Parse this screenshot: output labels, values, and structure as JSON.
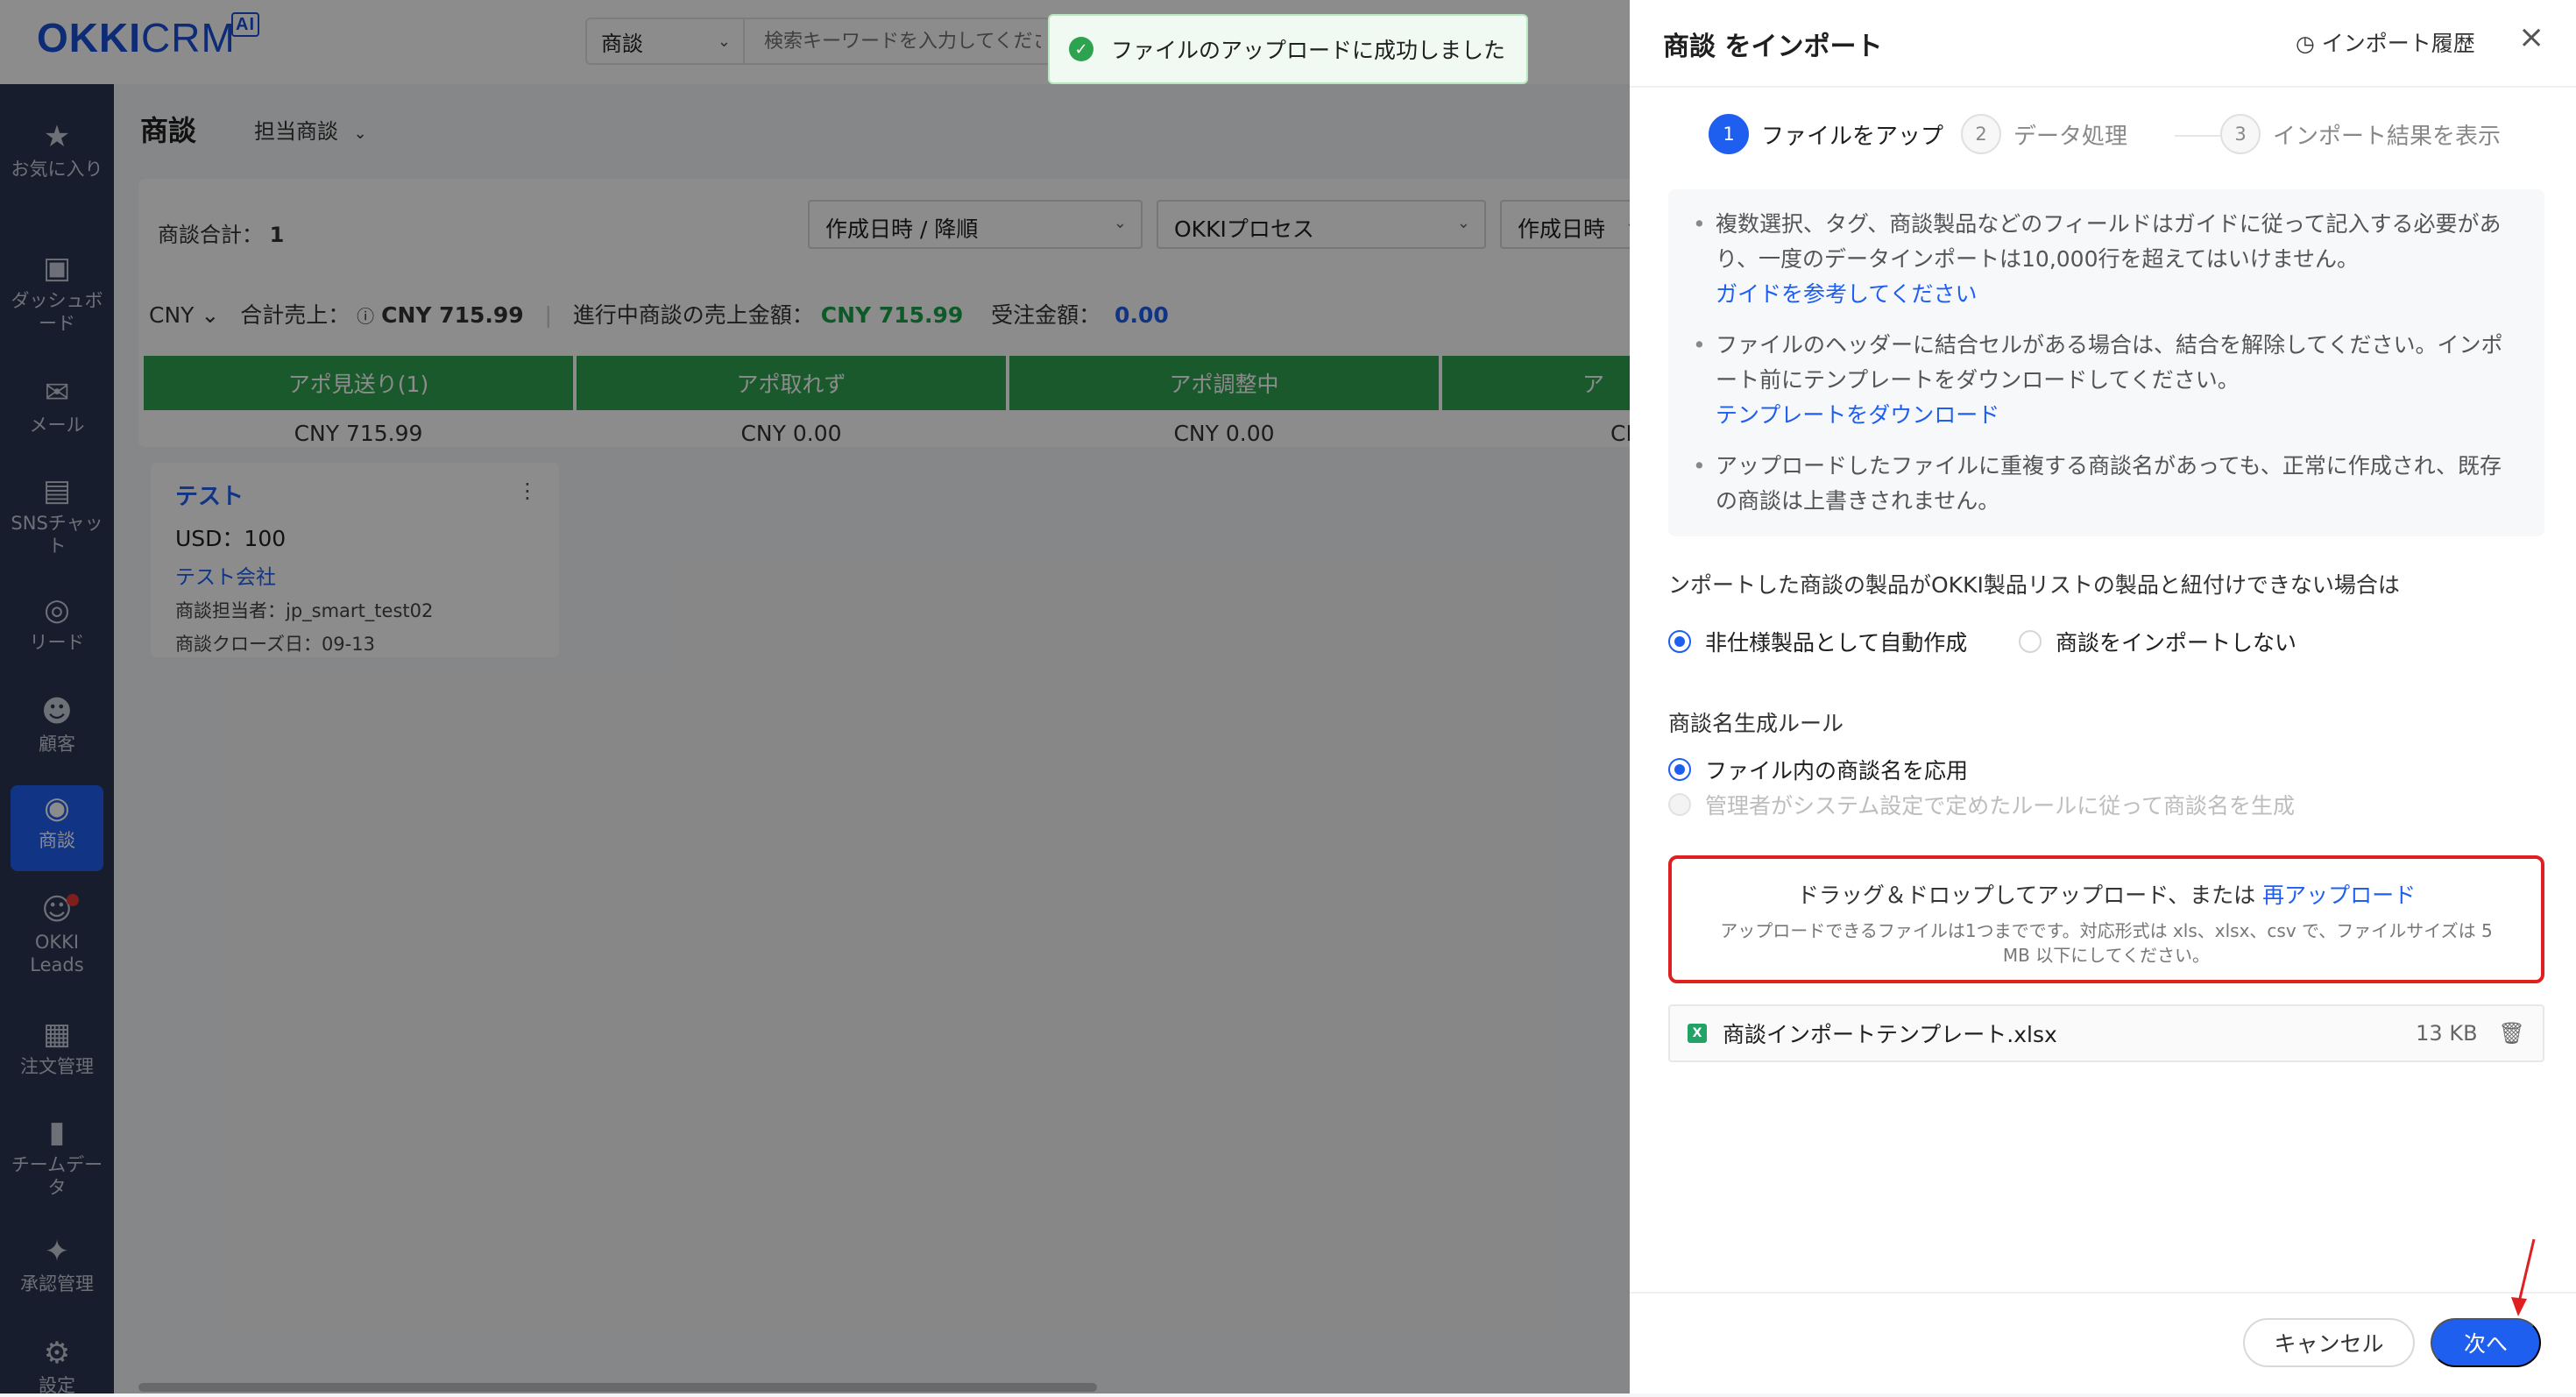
{
  "header": {
    "logo_main": "OKKI",
    "logo_crm": "CRM",
    "logo_ai": "AI",
    "search_scope": "商談",
    "search_placeholder": "検索キーワードを入力してください"
  },
  "sidebar": {
    "items": [
      {
        "label": "お気に入り",
        "icon": "star-icon"
      },
      {
        "label": "ダッシュボード",
        "icon": "dashboard-icon"
      },
      {
        "label": "メール",
        "icon": "mail-icon"
      },
      {
        "label": "SNSチャット",
        "icon": "chat-icon"
      },
      {
        "label": "リード",
        "icon": "lead-icon"
      },
      {
        "label": "顧客",
        "icon": "customers-icon"
      },
      {
        "label": "商談",
        "icon": "target-icon"
      },
      {
        "label": "OKKI Leads",
        "icon": "okki-leads-icon"
      },
      {
        "label": "注文管理",
        "icon": "order-icon"
      },
      {
        "label": "チームデータ",
        "icon": "bar-chart-icon"
      },
      {
        "label": "承認管理",
        "icon": "approval-icon"
      },
      {
        "label": "設定",
        "icon": "settings-icon"
      }
    ]
  },
  "main": {
    "title": "商談",
    "view": "担当商談",
    "count_label": "商談合計：",
    "count_value": "1",
    "sort": "作成日時 / 降順",
    "process": "OKKIプロセス",
    "date_filter": "作成日時",
    "currency": "CNY",
    "total_label": "合計売上：",
    "total_value": "CNY 715.99",
    "inprogress_label": "進行中商談の売上金額：",
    "inprogress_value": "CNY 715.99",
    "won_label": "受注金額：",
    "won_value": "0.00",
    "stages": [
      {
        "name": "アポ見送り(1)",
        "amount": "CNY 715.99"
      },
      {
        "name": "アポ取れず",
        "amount": "CNY 0.00"
      },
      {
        "name": "アポ調整中",
        "amount": "CNY 0.00"
      },
      {
        "name": "ア",
        "amount": "CN"
      }
    ],
    "deal": {
      "title": "テスト",
      "amount": "USD：100",
      "company": "テスト会社",
      "owner": "商談担当者：jp_smart_test02",
      "close_date": "商談クローズ日：09-13"
    }
  },
  "toast": {
    "message": "ファイルのアップロードに成功しました"
  },
  "drawer": {
    "title": "商談 をインポート",
    "history": "インポート履歴",
    "steps": [
      {
        "num": "1",
        "label": "ファイルをアップ"
      },
      {
        "num": "2",
        "label": "データ処理"
      },
      {
        "num": "3",
        "label": "インポート結果を表示"
      }
    ],
    "notes": [
      {
        "text": "複数選択、タグ、商談製品などのフィールドはガイドに従って記入する必要があり、一度のデータインポートは10,000行を超えてはいけません。",
        "link": "ガイドを参考してください"
      },
      {
        "text": "ファイルのヘッダーに結合セルがある場合は、結合を解除してください。インポート前にテンプレートをダウンロードしてください。",
        "link": "テンプレートをダウンロード"
      },
      {
        "text": "アップロードしたファイルに重複する商談名があっても、正常に作成され、既存の商談は上書きされません。",
        "link": ""
      }
    ],
    "product_question": "ンポートした商談の製品がOKKI製品リストの製品と紐付けできない場合は",
    "product_options": [
      "非仕様製品として自動作成",
      "商談をインポートしない"
    ],
    "name_rule_label": "商談名生成ルール",
    "name_rule_options": [
      "ファイル内の商談名を応用",
      "管理者がシステム設定で定めたルールに従って商談名を生成"
    ],
    "dropzone_text": "ドラッグ＆ドロップしてアップロード、または",
    "dropzone_link": "再アップロード",
    "dropzone_hint": "アップロードできるファイルは1つまでです。対応形式は xls、xlsx、csv で、ファイルサイズは 5 MB 以下にしてください。",
    "file_name": "商談インポートテンプレート.xlsx",
    "file_size": "13 KB",
    "cancel": "キャンセル",
    "next": "次へ"
  }
}
